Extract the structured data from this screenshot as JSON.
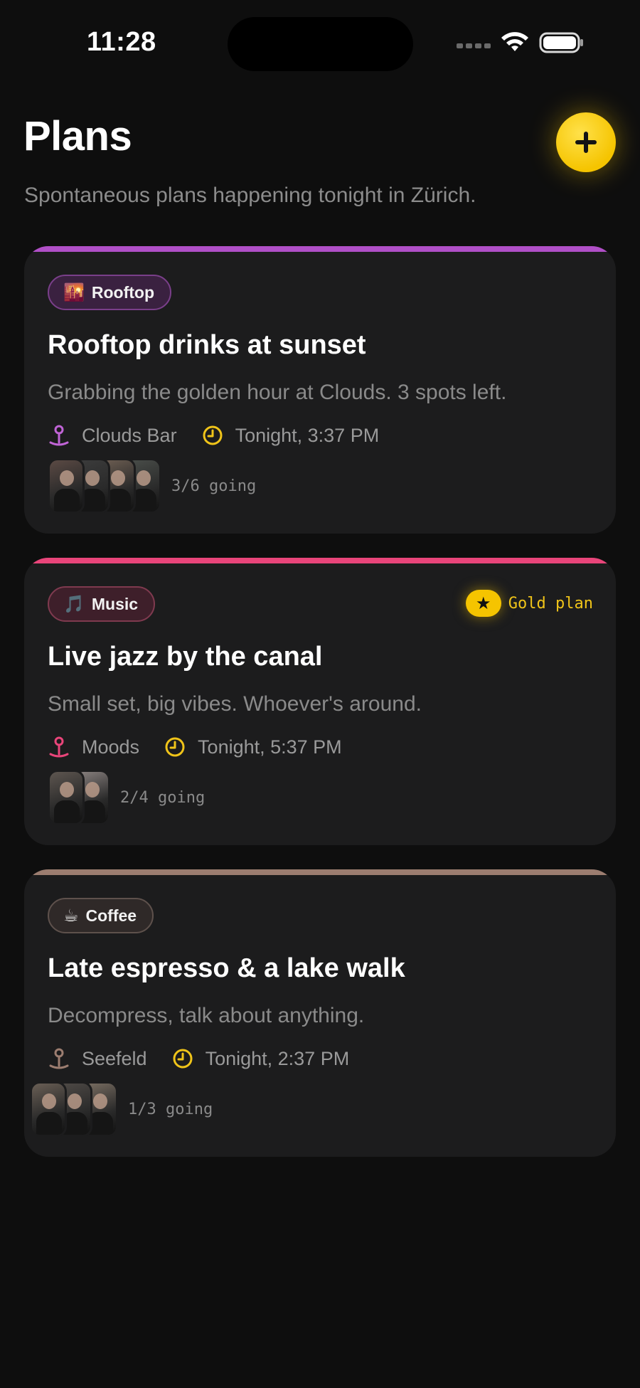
{
  "status_bar": {
    "time": "11:28"
  },
  "header": {
    "title": "Plans",
    "subtitle": "Spontaneous plans happening tonight in Zürich.",
    "add_label": "+"
  },
  "plans": [
    {
      "tag": {
        "emoji": "🌇",
        "label": "Rooftop"
      },
      "title": "Rooftop drinks at sunset",
      "description": "Grabbing the golden hour at Clouds. 3 spots left.",
      "location": "Clouds Bar",
      "time": "Tonight, 3:37 PM",
      "going": "3/6 going",
      "accent": "#b04fc7",
      "tag_bg": "#3a2140",
      "tag_border": "#7a3f8a",
      "pin_color": "#c064d6",
      "avatars": [
        "#5b4a44",
        "#3c3c3c",
        "#6d5e52",
        "#4a4e4a"
      ]
    },
    {
      "tag": {
        "emoji": "🎵",
        "label": "Music"
      },
      "title": "Live jazz by the canal",
      "description": "Small set, big vibes. Whoever's around.",
      "location": "Moods",
      "time": "Tonight, 5:37 PM",
      "going": "2/4 going",
      "accent": "#e9457a",
      "tag_bg": "#3e1f2a",
      "tag_border": "#7f3a4f",
      "pin_color": "#e9457a",
      "gold_badge": {
        "star": "★",
        "label": "Gold plan"
      },
      "avatars": [
        "#5e5650",
        "#8a8280"
      ]
    },
    {
      "tag": {
        "emoji": "☕",
        "label": "Coffee"
      },
      "title": "Late espresso & a lake walk",
      "description": "Decompress, talk about anything.",
      "location": "Seefeld",
      "time": "Tonight, 2:37 PM",
      "going": "1/3 going",
      "accent": "#9c7d70",
      "tag_bg": "#2f2928",
      "tag_border": "#5e514c",
      "pin_color": "#9c7d70",
      "avatars": [
        "#6a5f55",
        "#4f4a46",
        "#7a6e62"
      ]
    }
  ],
  "colors": {
    "background": "#0e0e0e",
    "card": "#1c1c1d",
    "gold": "#f5c400",
    "clock_icon": "#f0c419"
  }
}
